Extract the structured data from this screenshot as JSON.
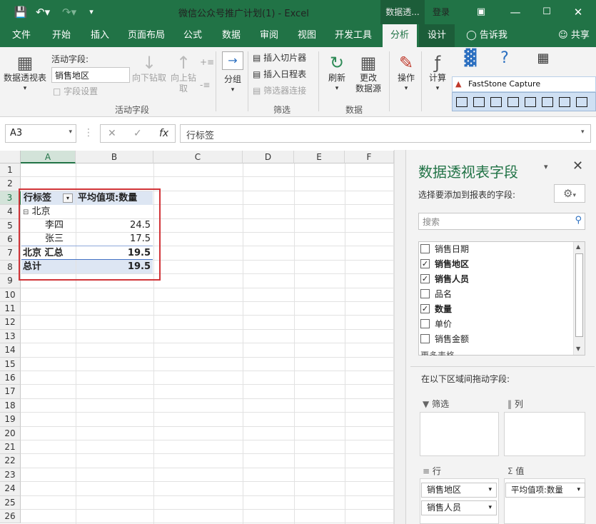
{
  "window": {
    "title": "微信公众号推广计划(1)  -  Excel",
    "context_tab": "数据透...",
    "login": "登录",
    "share": "共享",
    "tell_me": "告诉我"
  },
  "tabs": [
    "文件",
    "开始",
    "插入",
    "页面布局",
    "公式",
    "数据",
    "审阅",
    "视图",
    "开发工具",
    "分析",
    "设计"
  ],
  "ribbon": {
    "pivot_table": "数据透视表",
    "active_field_label": "活动字段:",
    "active_field_value": "销售地区",
    "field_settings": "字段设置",
    "drill_down": "向下钻取",
    "drill_up_1": "向上钻",
    "drill_up_2": "取",
    "group_active_field": "活动字段",
    "group_btn": "分组",
    "insert_slicer": "插入切片器",
    "insert_timeline": "插入日程表",
    "filter_connections": "筛选器连接",
    "group_filter": "筛选",
    "refresh": "刷新",
    "change_source_1": "更改",
    "change_source_2": "数据源",
    "group_data": "数据",
    "actions": "操作",
    "calculations": "计算",
    "faststone": "FastStone Capture"
  },
  "formula_bar": {
    "name_box": "A3",
    "fx": "fx",
    "content": "行标签"
  },
  "sheet": {
    "columns": [
      "A",
      "B",
      "C",
      "D",
      "E",
      "F"
    ],
    "rows": [
      "1",
      "2",
      "3",
      "4",
      "5",
      "6",
      "7",
      "8",
      "9",
      "10",
      "11",
      "12",
      "13",
      "14",
      "15",
      "16",
      "17",
      "18",
      "19",
      "20",
      "21",
      "22",
      "23",
      "24",
      "25",
      "26"
    ],
    "pivot": {
      "header_row_label": "行标签",
      "header_value": "平均值项:数量",
      "group": "北京",
      "items": [
        {
          "name": "李四",
          "value": "24.5"
        },
        {
          "name": "张三",
          "value": "17.5"
        }
      ],
      "subtotal_label": "北京 汇总",
      "subtotal_value": "19.5",
      "grand_total_label": "总计",
      "grand_total_value": "19.5"
    }
  },
  "pane": {
    "title": "数据透视表字段",
    "subtitle": "选择要添加到报表的字段:",
    "search_placeholder": "搜索",
    "fields": [
      {
        "name": "销售日期",
        "checked": false
      },
      {
        "name": "销售地区",
        "checked": true
      },
      {
        "name": "销售人员",
        "checked": true
      },
      {
        "name": "品名",
        "checked": false
      },
      {
        "name": "数量",
        "checked": true
      },
      {
        "name": "单价",
        "checked": false
      },
      {
        "name": "销售金额",
        "checked": false
      }
    ],
    "more_tables": "更多表格...",
    "drag_hint": "在以下区域间拖动字段:",
    "area_filters": "筛选",
    "area_columns": "列",
    "area_rows": "行",
    "area_values": "值",
    "row_chips": [
      "销售地区",
      "销售人员"
    ],
    "value_chips": [
      "平均值项:数量"
    ]
  },
  "colors": {
    "excel_green": "#217346",
    "pivot_header": "#dde6f3",
    "highlight_red": "#d13438"
  }
}
